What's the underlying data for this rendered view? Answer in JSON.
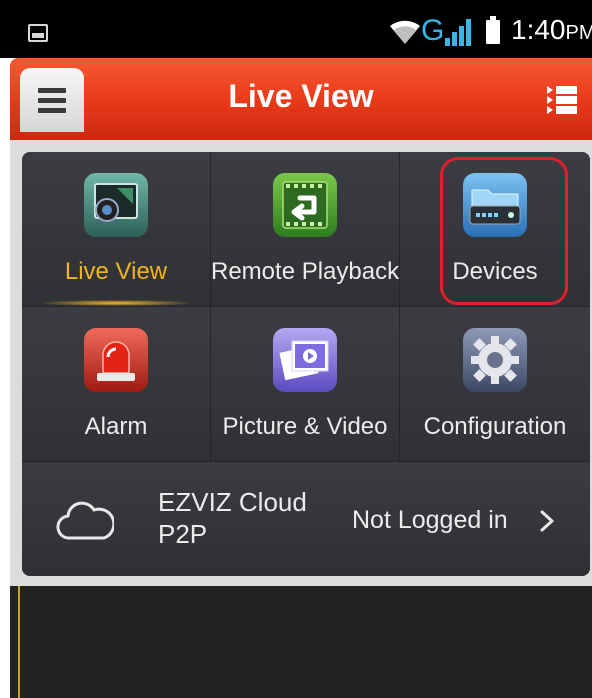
{
  "status_bar": {
    "network": "G",
    "time": "1:40",
    "ampm": "PM"
  },
  "header": {
    "title": "Live View",
    "icons": {
      "menu": "hamburger-menu-icon",
      "list": "list-view-icon"
    }
  },
  "menu_tiles": [
    {
      "label": "Live View",
      "icon": "camera-monitor-icon",
      "active": true
    },
    {
      "label": "Remote Playback",
      "icon": "playback-film-icon",
      "active": false
    },
    {
      "label": "Devices",
      "icon": "dvr-device-folder-icon",
      "active": false,
      "highlighted": true
    },
    {
      "label": "Alarm",
      "icon": "alarm-siren-icon",
      "active": false
    },
    {
      "label": "Picture & Video",
      "icon": "gallery-photo-icon",
      "active": false
    },
    {
      "label": "Configuration",
      "icon": "gear-icon",
      "active": false
    }
  ],
  "cloud": {
    "title": "EZVIZ Cloud P2P",
    "status": "Not Logged in",
    "icon": "cloud-icon"
  },
  "colors": {
    "header": "#e8381a",
    "active_label": "#f2b41e",
    "highlight_box": "#e0202a",
    "panel": "#35373b"
  }
}
